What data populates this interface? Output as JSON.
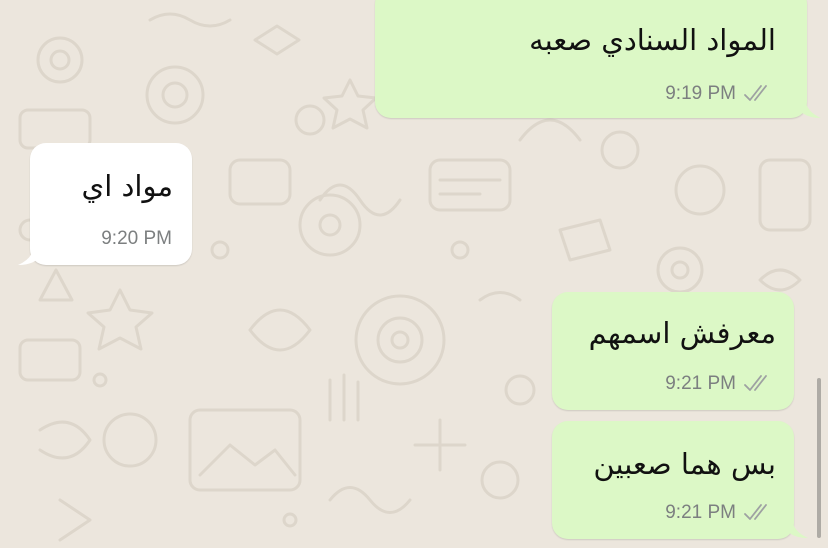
{
  "theme": {
    "wallpaper": "#ece6dd",
    "outgoing_bubble": "#dcf8c6",
    "incoming_bubble": "#ffffff",
    "delivered_tick": "#9ea1a2"
  },
  "messages": [
    {
      "direction": "outgoing",
      "text": "المواد السنادي صعبه",
      "time": "9:19 PM",
      "status": "delivered-double-tick"
    },
    {
      "direction": "incoming",
      "text": "مواد اي",
      "time": "9:20 PM"
    },
    {
      "direction": "outgoing",
      "text": "معرفش اسمهم",
      "time": "9:21 PM",
      "status": "delivered-double-tick"
    },
    {
      "direction": "outgoing",
      "text": "بس هما صعبين",
      "time": "9:21 PM",
      "status": "delivered-double-tick"
    }
  ]
}
